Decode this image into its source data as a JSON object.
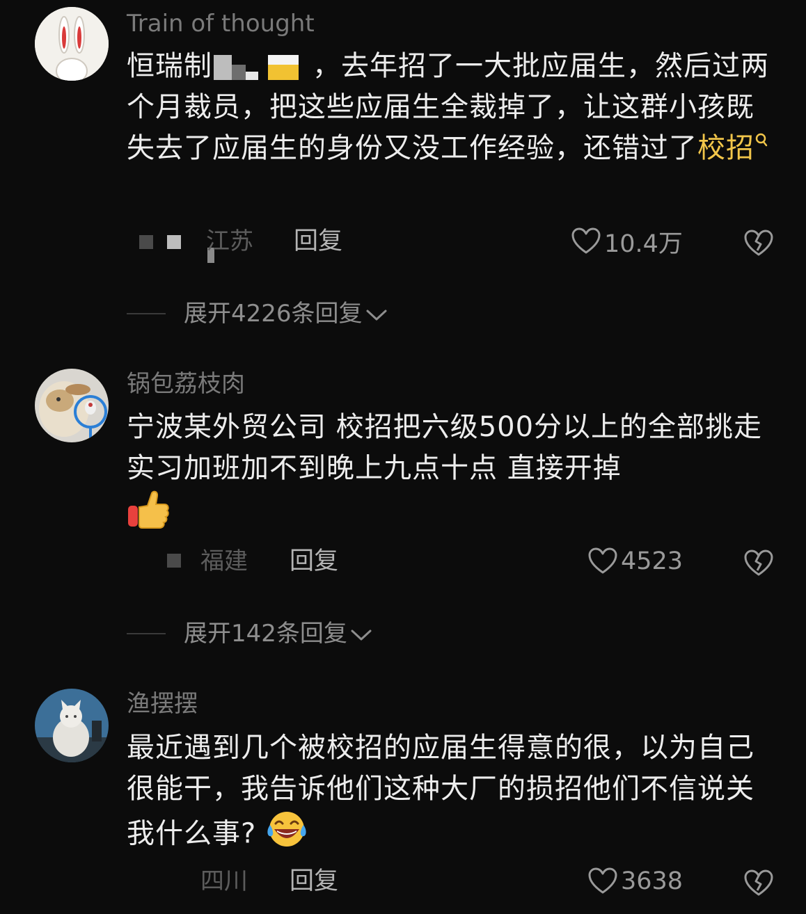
{
  "comments": [
    {
      "username": "Train of thought",
      "text_prefix": "恒瑞制",
      "text_rest": "，去年招了一大批应届生，然后过两个月裁员，把这些应届生全裁掉了，让这群小孩既失去了应届生的身份又没工作经验，还错过了",
      "text_highlight": "校招",
      "highlight_icon": "search-icon",
      "location": "江苏",
      "reply_label": "回复",
      "likes": "10.4万",
      "expand_label": "展开4226条回复",
      "avatar_icon": "rabbit-avatar"
    },
    {
      "username": "锅包荔枝肉",
      "text": "宁波某外贸公司 校招把六级500分以上的全部挑走 实习加班加不到晚上九点十点 直接开掉",
      "emoji": "thumbs-up-emoji",
      "location": "福建",
      "reply_label": "回复",
      "likes": "4523",
      "expand_label": "展开142条回复",
      "avatar_icon": "dog-avatar"
    },
    {
      "username": "渔摆摆",
      "text": "最近遇到几个被校招的应届生得意的很，以为自己很能干，我告诉他们这种大厂的损招他们不信说关我什么事?",
      "emoji": "laughing-tears-emoji",
      "location": "四川",
      "reply_label": "回复",
      "likes": "3638",
      "avatar_icon": "cat-avatar"
    }
  ],
  "colors": {
    "background": "#0c0c0c",
    "text": "#ededed",
    "username": "#7a7a7a",
    "highlight": "#f2c64a",
    "muted": "#5c5c5c"
  }
}
